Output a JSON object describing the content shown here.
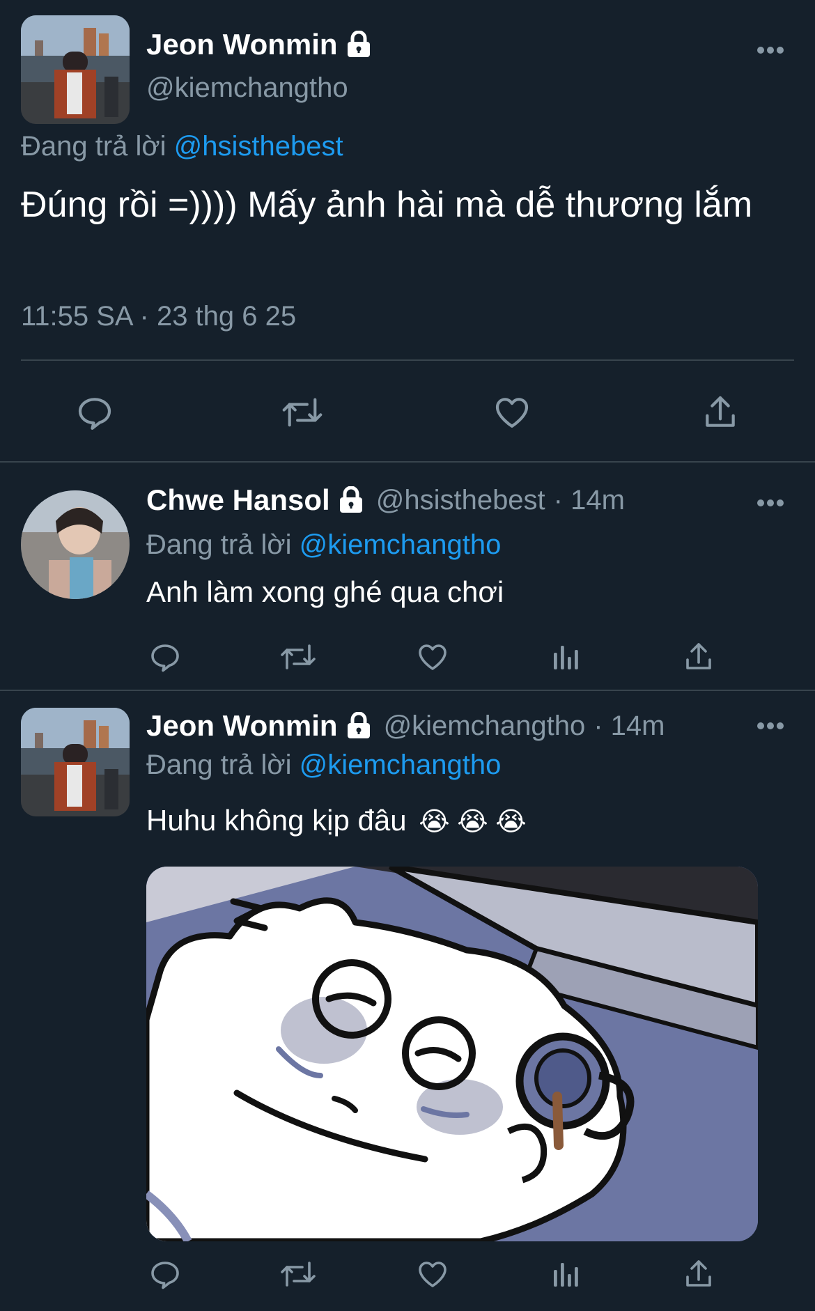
{
  "main_tweet": {
    "author_name": "Jeon Wonmin",
    "author_handle": "@kiemchangtho",
    "reply_prefix": "Đang trả lời",
    "reply_to": "@hsisthebest",
    "text": "Đúng rồi =)))) Mấy ảnh hài mà dễ thương lắm",
    "timestamp": "11:55 SA · 23 thg 6 25",
    "icons": [
      "reply-icon",
      "retweet-icon",
      "like-icon",
      "share-icon"
    ]
  },
  "replies": [
    {
      "author_name": "Chwe Hansol",
      "author_handle": "@hsisthebest",
      "time": "· 14m",
      "reply_prefix": "Đang trả lời",
      "reply_to": "@kiemchangtho",
      "text": "Anh làm xong ghé qua chơi",
      "icons": [
        "reply-icon",
        "retweet-icon",
        "like-icon",
        "analytics-icon",
        "share-icon"
      ]
    },
    {
      "author_name": "Jeon Wonmin",
      "author_handle": "@kiemchangtho",
      "time": "· 14m",
      "reply_prefix": "Đang trả lời",
      "reply_to": "@kiemchangtho",
      "text": "Huhu không kịp đâu",
      "emojis": "😭 😭 😭",
      "icons": [
        "reply-icon",
        "retweet-icon",
        "like-icon",
        "analytics-icon",
        "share-icon"
      ]
    }
  ],
  "colors": {
    "background": "#15202b",
    "link": "#1d9bf0",
    "muted": "#8899a6",
    "divider": "#38444d"
  }
}
